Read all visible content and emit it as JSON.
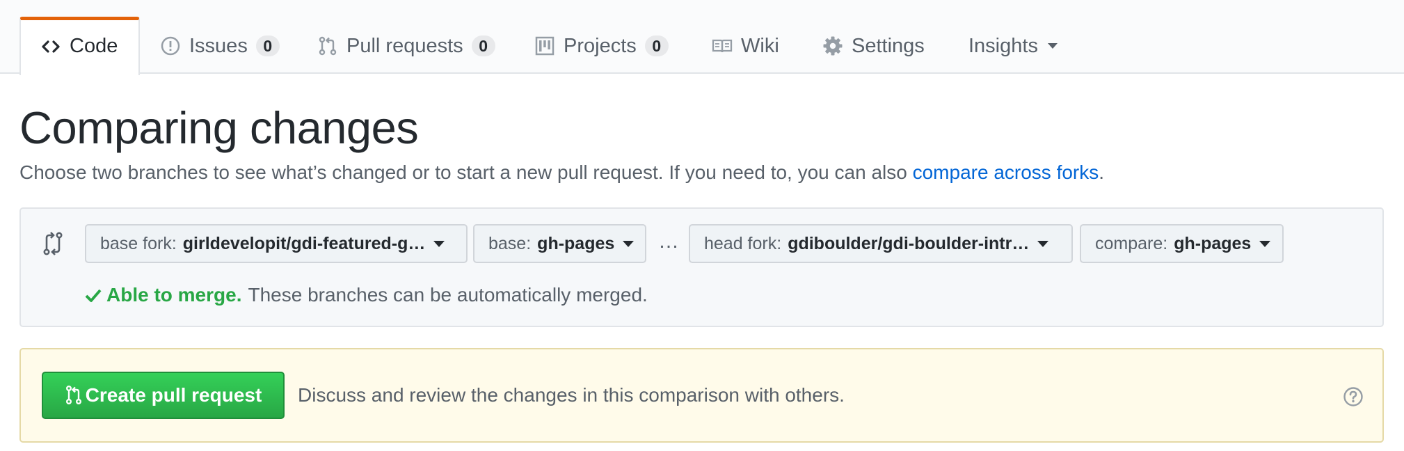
{
  "tabs": [
    {
      "label": "Code",
      "icon": "code-icon",
      "selected": true
    },
    {
      "label": "Issues",
      "icon": "issue-icon",
      "count": "0"
    },
    {
      "label": "Pull requests",
      "icon": "git-pull-request-icon",
      "count": "0"
    },
    {
      "label": "Projects",
      "icon": "project-icon",
      "count": "0"
    },
    {
      "label": "Wiki",
      "icon": "book-icon"
    },
    {
      "label": "Settings",
      "icon": "gear-icon"
    },
    {
      "label": "Insights",
      "icon": "chevron-down-icon"
    }
  ],
  "page": {
    "title": "Comparing changes",
    "subtitle_text": "Choose two branches to see what’s changed or to start a new pull request. If you need to, you can also ",
    "subtitle_link": "compare across forks",
    "subtitle_end": "."
  },
  "range": {
    "base_fork": {
      "label": "base fork:",
      "value": "girldevelopit/gdi-featured-g…"
    },
    "base": {
      "label": "base:",
      "value": "gh-pages"
    },
    "separator": "…",
    "head_fork": {
      "label": "head fork:",
      "value": "gdiboulder/gdi-boulder-intr…"
    },
    "compare": {
      "label": "compare:",
      "value": "gh-pages"
    },
    "merge_status": "Able to merge.",
    "merge_message": "These branches can be automatically merged."
  },
  "create_pr": {
    "button_label": "Create pull request",
    "description": "Discuss and review the changes in this comparison with others."
  },
  "colors": {
    "accent_tab": "#e36209",
    "link": "#0366d6",
    "success": "#28a745",
    "notice_bg": "#fffbea"
  }
}
